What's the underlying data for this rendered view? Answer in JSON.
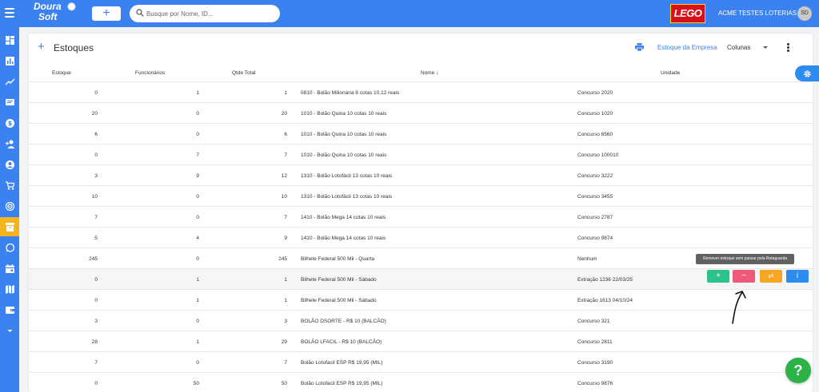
{
  "header": {
    "logo_line1": "Doura",
    "logo_line2": "Soft",
    "add_label": "+",
    "search_placeholder": "Busque por Nome, ID...",
    "brand_logo_text": "LEGO",
    "company_name": "ACME TESTES LOTERIAS",
    "avatar_initials": "SD",
    "colors": {
      "primary": "#3b82f0",
      "accent": "#f5b31c"
    }
  },
  "sidebar": {
    "items": [
      {
        "icon": "dashboard-icon",
        "active": false
      },
      {
        "icon": "bar-chart-icon",
        "active": false
      },
      {
        "icon": "trending-icon",
        "active": false
      },
      {
        "icon": "message-icon",
        "active": false
      },
      {
        "icon": "money-icon",
        "active": false
      },
      {
        "icon": "add-user-icon",
        "active": false
      },
      {
        "icon": "account-icon",
        "active": false
      },
      {
        "icon": "cart-icon",
        "active": false
      },
      {
        "icon": "target-icon",
        "active": false
      },
      {
        "icon": "inventory-icon",
        "active": true
      },
      {
        "icon": "whatsapp-icon",
        "active": false
      },
      {
        "icon": "calendar-icon",
        "active": false
      },
      {
        "icon": "map-icon",
        "active": false
      },
      {
        "icon": "wallet-icon",
        "active": false
      },
      {
        "icon": "expand-more-icon",
        "active": false
      }
    ]
  },
  "page": {
    "add_symbol": "+",
    "title": "Estoques",
    "empresa_link": "Estoque da Empresa",
    "colunas_label": "Colunas"
  },
  "table": {
    "headers": {
      "estoque": "Estoque",
      "funcionarios": "Funcionários",
      "qtde_total": "Qtde Total",
      "nome": "Nome",
      "sort_arrow": "↓",
      "unidade": "Unidade"
    },
    "rows": [
      {
        "estoque": "0",
        "funcionarios": "1",
        "qtde_total": "1",
        "nome": "0810 - Bolão Milionária 8 cotas 10,12 reais",
        "unidade": "Concurso 2020"
      },
      {
        "estoque": "20",
        "funcionarios": "0",
        "qtde_total": "20",
        "nome": "1010 - Bolão Quina 10 cotas 10 reais",
        "unidade": "Concurso 1020"
      },
      {
        "estoque": "6",
        "funcionarios": "0",
        "qtde_total": "6",
        "nome": "1010 - Bolão Quina 10 cotas 10 reais",
        "unidade": "Concurso 6560"
      },
      {
        "estoque": "0",
        "funcionarios": "7",
        "qtde_total": "7",
        "nome": "1010 - Bolão Quina 10 cotas 10 reais",
        "unidade": "Concurso 100010"
      },
      {
        "estoque": "3",
        "funcionarios": "9",
        "qtde_total": "12",
        "nome": "1310 - Bolão Lotofácil 13 cotas 10 reais",
        "unidade": "Concurso 3222"
      },
      {
        "estoque": "10",
        "funcionarios": "0",
        "qtde_total": "10",
        "nome": "1310 - Bolão Lotofácil 13 cotas 10 reais",
        "unidade": "Concurso 3455"
      },
      {
        "estoque": "7",
        "funcionarios": "0",
        "qtde_total": "7",
        "nome": "1410 - Bolão Mega 14 cotas 10 reais",
        "unidade": "Concurso 2787"
      },
      {
        "estoque": "5",
        "funcionarios": "4",
        "qtde_total": "9",
        "nome": "1410 - Bolão Mega 14 cotas 10 reais",
        "unidade": "Concurso 9874"
      },
      {
        "estoque": "245",
        "funcionarios": "0",
        "qtde_total": "245",
        "nome": "Bilhete Federal 500 Mil - Quarta",
        "unidade": "Nenhum"
      },
      {
        "estoque": "0",
        "funcionarios": "1",
        "qtde_total": "1",
        "nome": "Bilhete Federal 500 Mil - Sábado",
        "unidade": "Extração 1236 22/03/25"
      },
      {
        "estoque": "0",
        "funcionarios": "1",
        "qtde_total": "1",
        "nome": "Bilhete Federal 500 Mil - Sábado",
        "unidade": "Extração 1613 04/10/24"
      },
      {
        "estoque": "3",
        "funcionarios": "0",
        "qtde_total": "3",
        "nome": "BOLÃO DSORTE - R$ 10 (BALCÃO)",
        "unidade": "Concurso 321"
      },
      {
        "estoque": "28",
        "funcionarios": "1",
        "qtde_total": "29",
        "nome": "BOLÃO LFACIL - R$ 10 (BALCÃO)",
        "unidade": "Concurso 2811"
      },
      {
        "estoque": "7",
        "funcionarios": "0",
        "qtde_total": "7",
        "nome": "Bolão Lotofacil ESP R$ 19,95 (MIL)",
        "unidade": "Concurso 3190"
      },
      {
        "estoque": "0",
        "funcionarios": "50",
        "qtde_total": "50",
        "nome": "Bolão Lotofacil ESP R$ 19,95 (MIL)",
        "unidade": "Concurso 9876"
      }
    ],
    "row_actions": {
      "add": "+",
      "remove": "−",
      "transfer": "⇄",
      "info": "i"
    },
    "tooltip": "Remover estoque sem passar pela Retaguarda"
  },
  "help_label": "?"
}
